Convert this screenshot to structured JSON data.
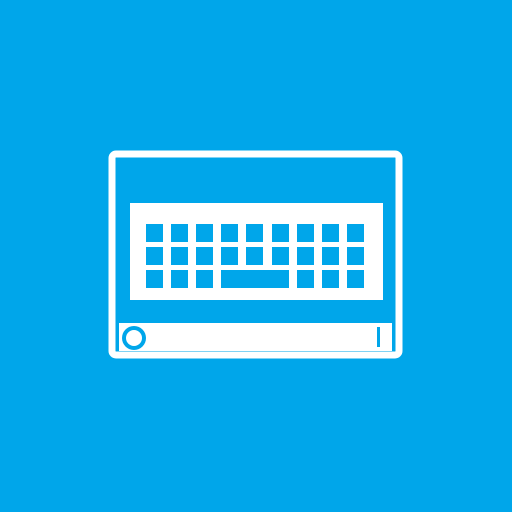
{
  "tile": {
    "icon": "on-screen-keyboard-icon",
    "background_color": "#00A6EA",
    "foreground_color": "#FFFFFF"
  }
}
